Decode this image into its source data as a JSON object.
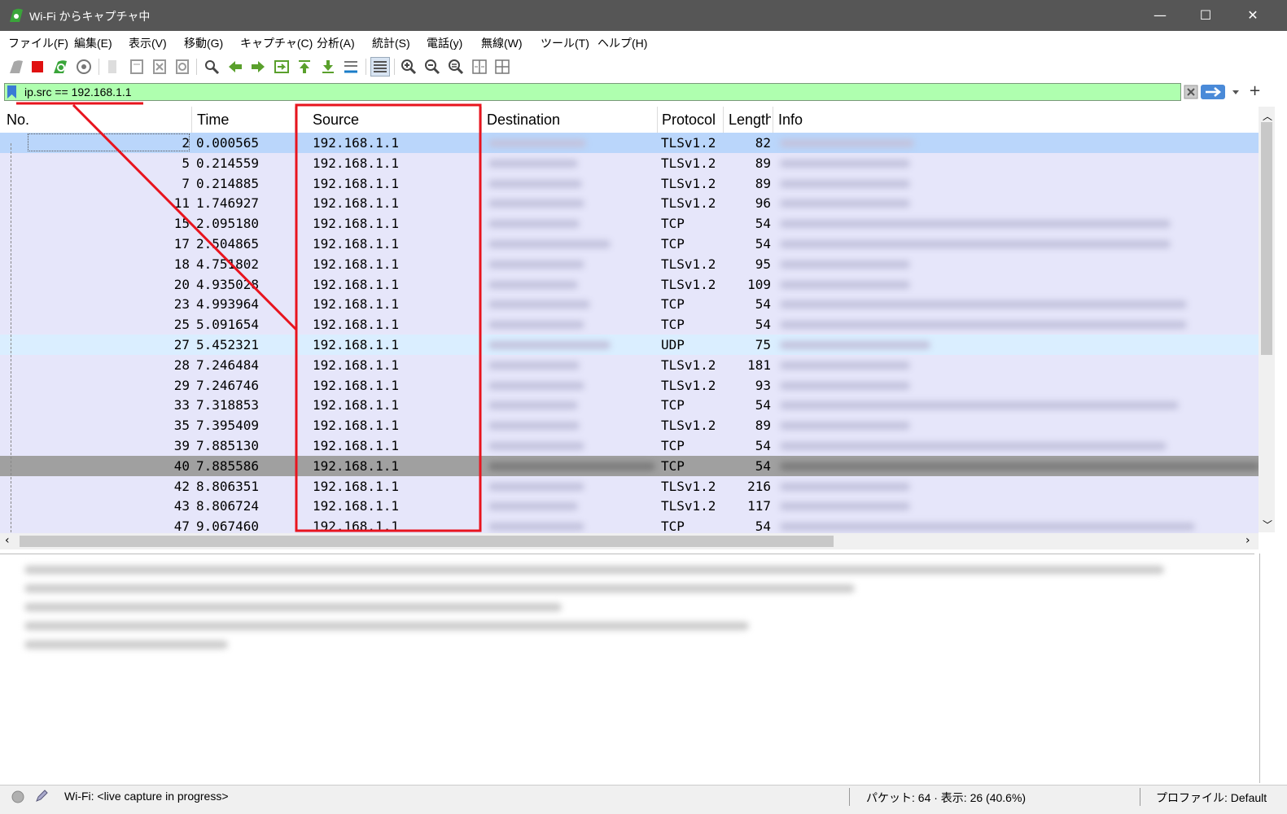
{
  "window": {
    "title": "Wi-Fi からキャプチャ中",
    "minimize": "—",
    "maximize": "☐",
    "close": "✕"
  },
  "menu": [
    "ファイル(F)",
    "編集(E)",
    "表示(V)",
    "移動(G)",
    "キャプチャ(C)",
    "分析(A)",
    "統計(S)",
    "電話(y)",
    "無線(W)",
    "ツール(T)",
    "ヘルプ(H)"
  ],
  "filter": {
    "value": "ip.src == 192.168.1.1"
  },
  "columns": [
    "No.",
    "Time",
    "Source",
    "Destination",
    "Protocol",
    "Length",
    "Info"
  ],
  "packets": [
    {
      "no": "2",
      "time": "0.000565",
      "src": "192.168.1.1",
      "proto": "TLSv1.2",
      "len": "82"
    },
    {
      "no": "5",
      "time": "0.214559",
      "src": "192.168.1.1",
      "proto": "TLSv1.2",
      "len": "89"
    },
    {
      "no": "7",
      "time": "0.214885",
      "src": "192.168.1.1",
      "proto": "TLSv1.2",
      "len": "89"
    },
    {
      "no": "11",
      "time": "1.746927",
      "src": "192.168.1.1",
      "proto": "TLSv1.2",
      "len": "96"
    },
    {
      "no": "15",
      "time": "2.095180",
      "src": "192.168.1.1",
      "proto": "TCP",
      "len": "54"
    },
    {
      "no": "17",
      "time": "2.504865",
      "src": "192.168.1.1",
      "proto": "TCP",
      "len": "54"
    },
    {
      "no": "18",
      "time": "4.751802",
      "src": "192.168.1.1",
      "proto": "TLSv1.2",
      "len": "95"
    },
    {
      "no": "20",
      "time": "4.935028",
      "src": "192.168.1.1",
      "proto": "TLSv1.2",
      "len": "109"
    },
    {
      "no": "23",
      "time": "4.993964",
      "src": "192.168.1.1",
      "proto": "TCP",
      "len": "54"
    },
    {
      "no": "25",
      "time": "5.091654",
      "src": "192.168.1.1",
      "proto": "TCP",
      "len": "54"
    },
    {
      "no": "27",
      "time": "5.452321",
      "src": "192.168.1.1",
      "proto": "UDP",
      "len": "75"
    },
    {
      "no": "28",
      "time": "7.246484",
      "src": "192.168.1.1",
      "proto": "TLSv1.2",
      "len": "181"
    },
    {
      "no": "29",
      "time": "7.246746",
      "src": "192.168.1.1",
      "proto": "TLSv1.2",
      "len": "93"
    },
    {
      "no": "33",
      "time": "7.318853",
      "src": "192.168.1.1",
      "proto": "TCP",
      "len": "54"
    },
    {
      "no": "35",
      "time": "7.395409",
      "src": "192.168.1.1",
      "proto": "TLSv1.2",
      "len": "89"
    },
    {
      "no": "39",
      "time": "7.885130",
      "src": "192.168.1.1",
      "proto": "TCP",
      "len": "54"
    },
    {
      "no": "40",
      "time": "7.885586",
      "src": "192.168.1.1",
      "proto": "TCP",
      "len": "54"
    },
    {
      "no": "42",
      "time": "8.806351",
      "src": "192.168.1.1",
      "proto": "TLSv1.2",
      "len": "216"
    },
    {
      "no": "43",
      "time": "8.806724",
      "src": "192.168.1.1",
      "proto": "TLSv1.2",
      "len": "117"
    },
    {
      "no": "47",
      "time": "9.067460",
      "src": "192.168.1.1",
      "proto": "TCP",
      "len": "54"
    }
  ],
  "status": {
    "interface": "Wi-Fi: <live capture in progress>",
    "packets": "パケット: 64 · 表示: 26 (40.6%)",
    "profile": "プロファイル: Default"
  },
  "colors": {
    "row_default": "#e6e6fa",
    "row_selected": "#bad6fb",
    "row_udp": "#daeeff",
    "row_marked": "#a0a0a0",
    "filter_valid": "#afffaf",
    "annotation": "#e8141e"
  }
}
